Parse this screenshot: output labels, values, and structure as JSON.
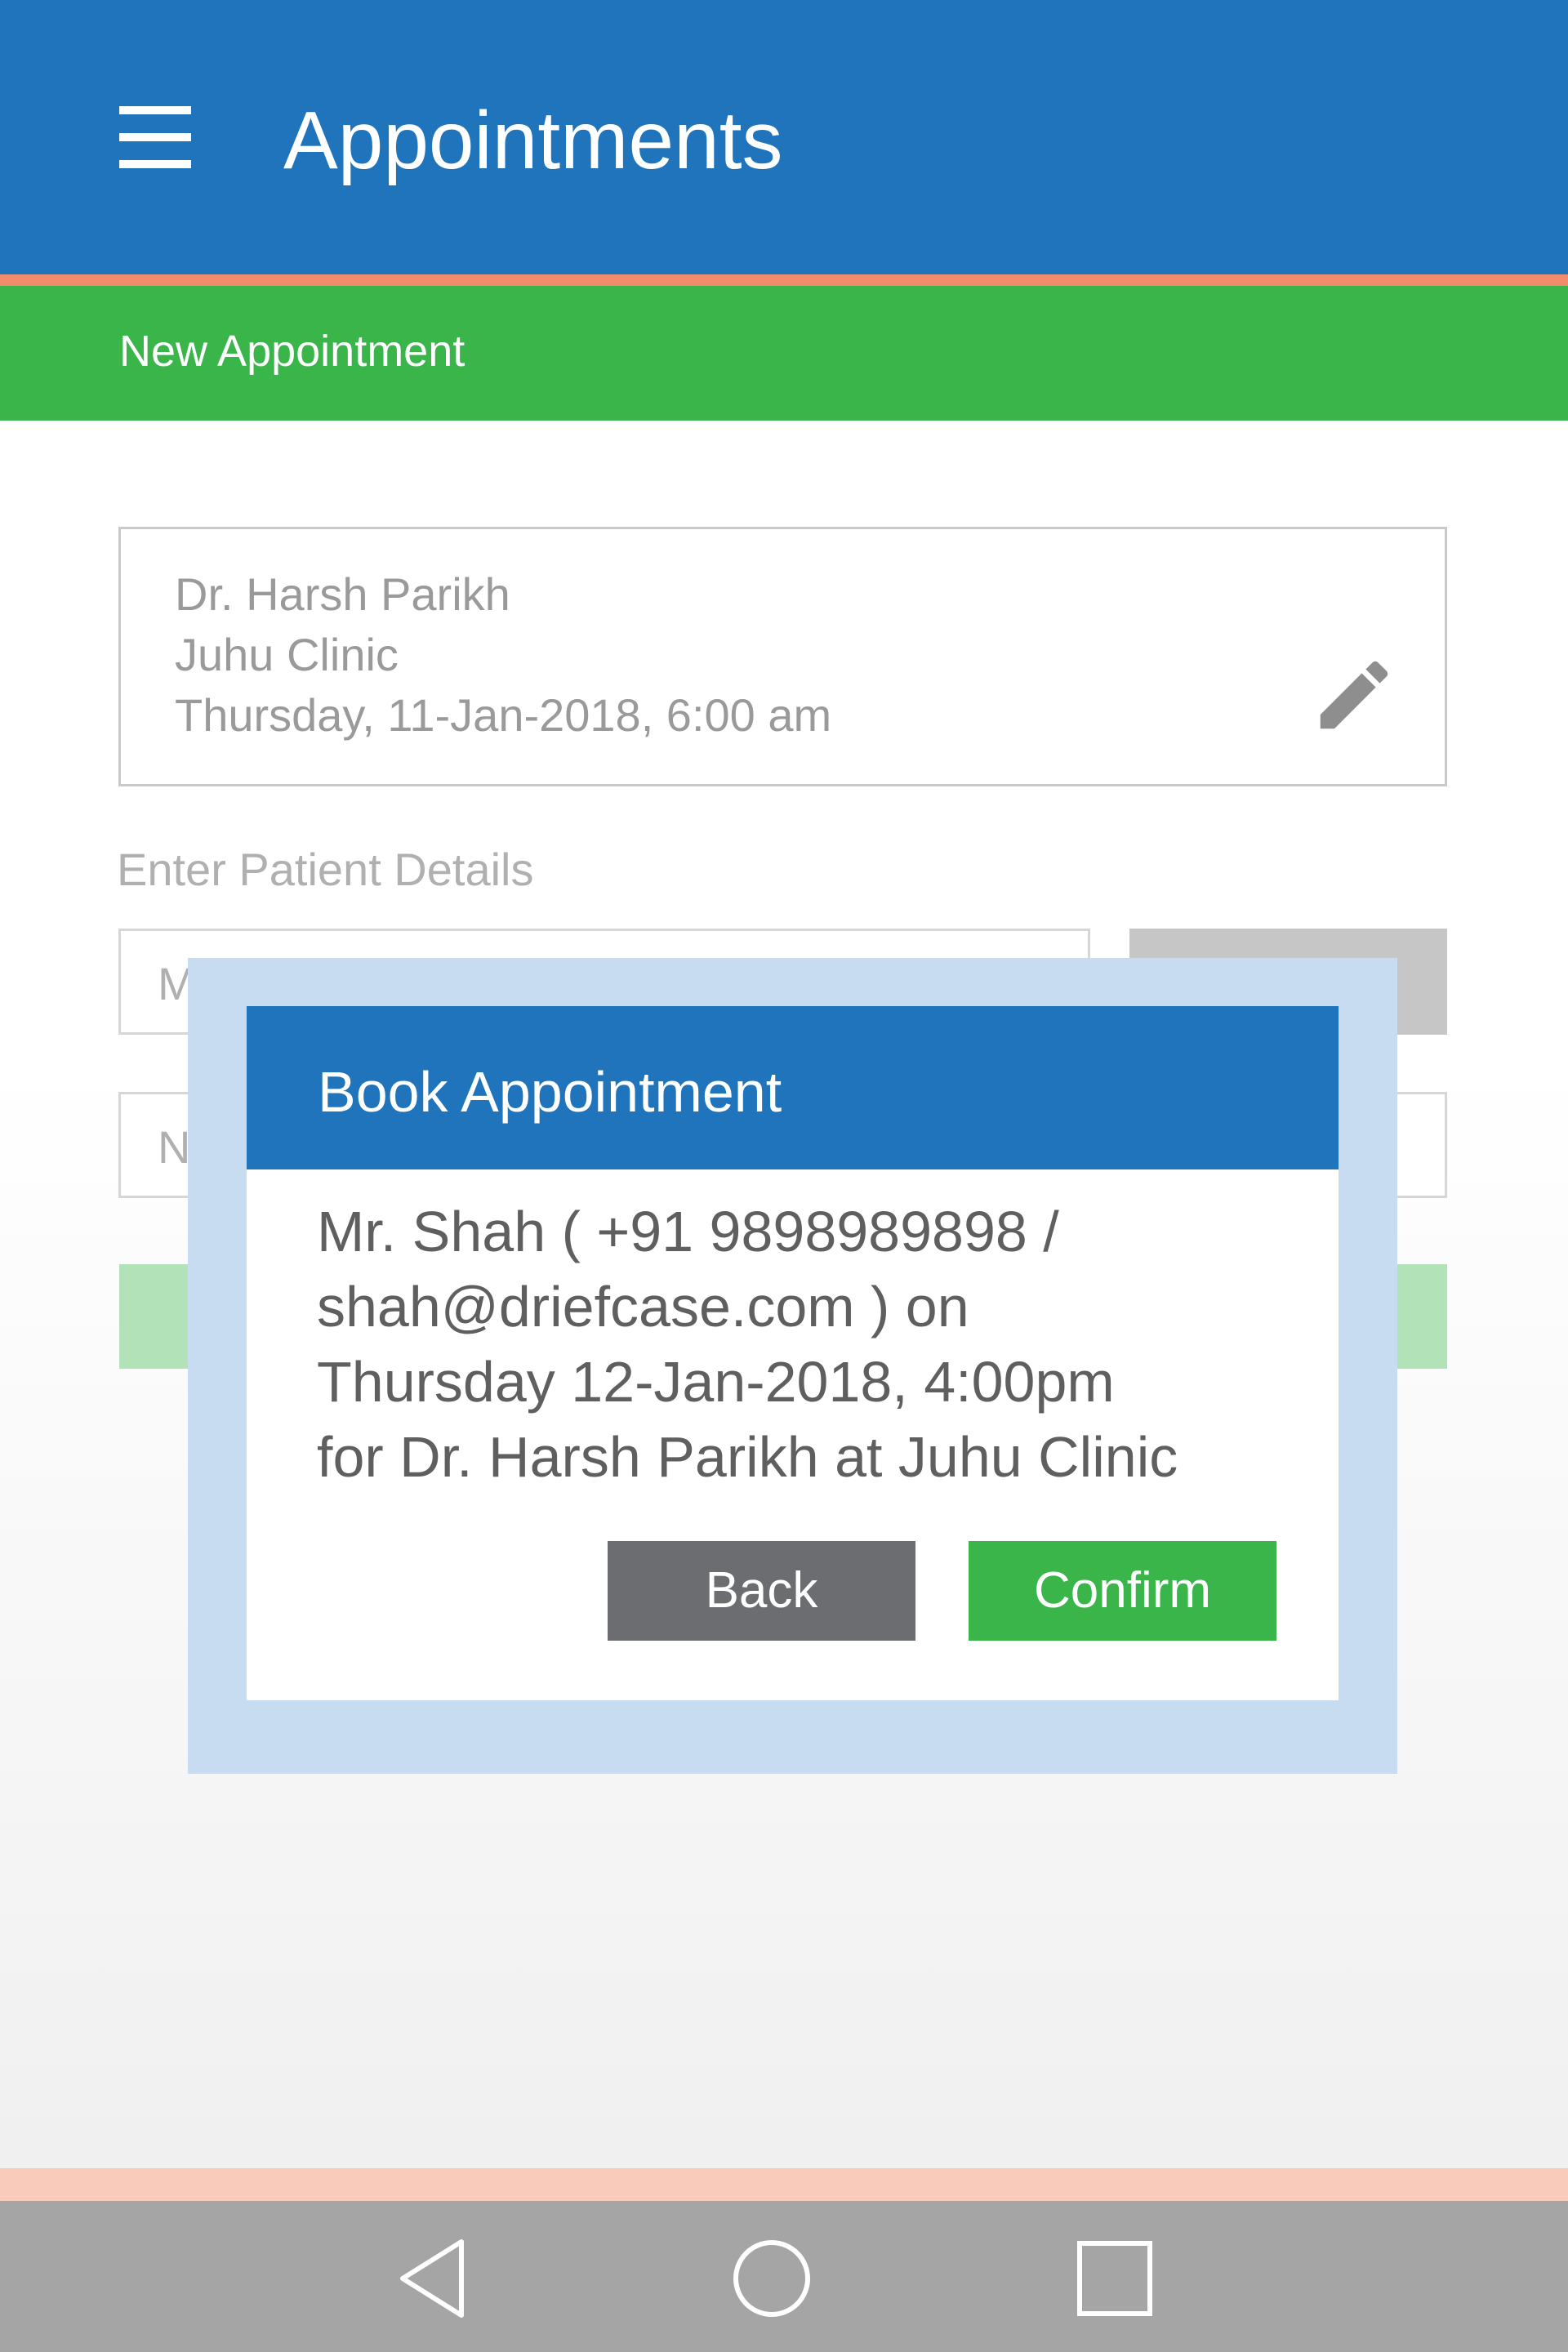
{
  "appbar": {
    "title": "Appointments",
    "menu_icon": "hamburger-menu-icon"
  },
  "subheader": {
    "title": "New Appointment"
  },
  "summary": {
    "doctor": "Dr. Harsh Parikh",
    "clinic": "Juhu Clinic",
    "datetime": "Thursday, 11-Jan-2018, 6:00 am",
    "edit_icon": "pencil-icon"
  },
  "patient_section": {
    "label": "Enter Patient Details",
    "mobile_hint_visible": "M",
    "name_hint_visible": "N"
  },
  "modal": {
    "title": "Book Appointment",
    "message_lines": [
      "Mr. Shah ( +91 9898989898 /",
      "shah@driefcase.com ) on",
      "Thursday 12-Jan-2018, 4:00pm",
      "for Dr. Harsh Parikh at Juhu Clinic"
    ],
    "back_label": "Back",
    "confirm_label": "Confirm"
  },
  "navbar": {
    "back_icon": "triangle-back-icon",
    "home_icon": "circle-home-icon",
    "recent_icon": "square-recents-icon"
  },
  "colors": {
    "primary_blue": "#1f74bb",
    "green": "#3ab54a",
    "accent_orange": "#f28c6c",
    "modal_overlay": "#c8dcf1",
    "back_gray": "#6b6d70"
  }
}
